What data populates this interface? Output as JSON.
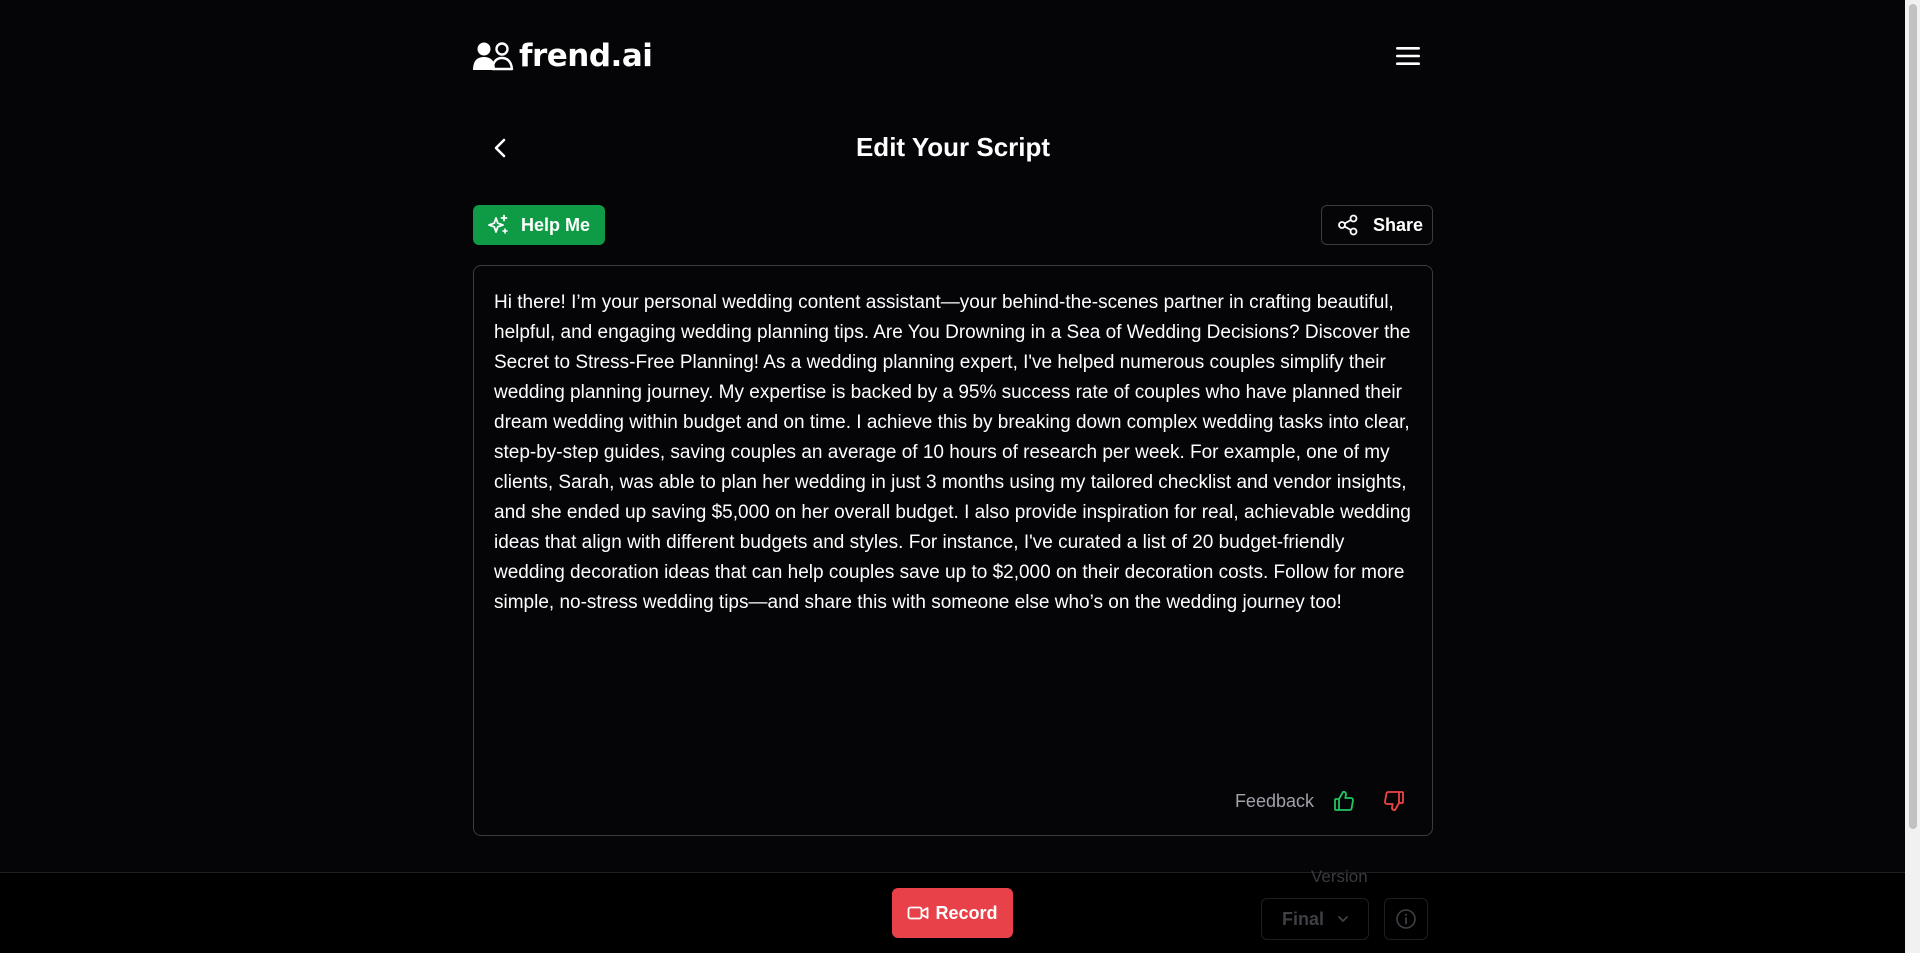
{
  "header": {
    "logo_text": "frend.ai",
    "logo_icon": "users-icon",
    "menu_icon": "hamburger-menu-icon"
  },
  "title_row": {
    "back_icon": "chevron-left-icon",
    "title": "Edit Your Script"
  },
  "toolbar": {
    "help_label": "Help Me",
    "help_icon": "sparkles-icon",
    "share_label": "Share",
    "share_icon": "share-icon"
  },
  "script": {
    "text": "Hi there! I’m your personal wedding content assistant—your behind-the-scenes partner in crafting beautiful, helpful, and engaging wedding planning tips. Are You Drowning in a Sea of Wedding Decisions? Discover the Secret to Stress-Free Planning! As a wedding planning expert, I've helped numerous couples simplify their wedding planning journey. My expertise is backed by a 95% success rate of couples who have planned their dream wedding within budget and on time. I achieve this by breaking down complex wedding tasks into clear, step-by-step guides, saving couples an average of 10 hours of research per week. For example, one of my clients, Sarah, was able to plan her wedding in just 3 months using my tailored checklist and vendor insights, and she ended up saving $5,000 on her overall budget. I also provide inspiration for real, achievable wedding ideas that align with different budgets and styles. For instance, I've curated a list of 20 budget-friendly wedding decoration ideas that can help couples save up to $2,000 on their decoration costs. Follow for more simple, no-stress wedding tips—and share this with someone else who’s on the wedding journey too!"
  },
  "feedback": {
    "label": "Feedback",
    "up_icon": "thumbs-up-icon",
    "down_icon": "thumbs-down-icon"
  },
  "bottom_bar": {
    "record_label": "Record",
    "record_icon": "video-camera-icon",
    "version_label": "Version",
    "version_value": "Final",
    "info_icon": "info-icon"
  },
  "colors": {
    "background": "#050508",
    "help_green": "#0f9a45",
    "record_red": "#e8414a",
    "thumb_up": "#22c55e",
    "thumb_down": "#ef4444"
  }
}
